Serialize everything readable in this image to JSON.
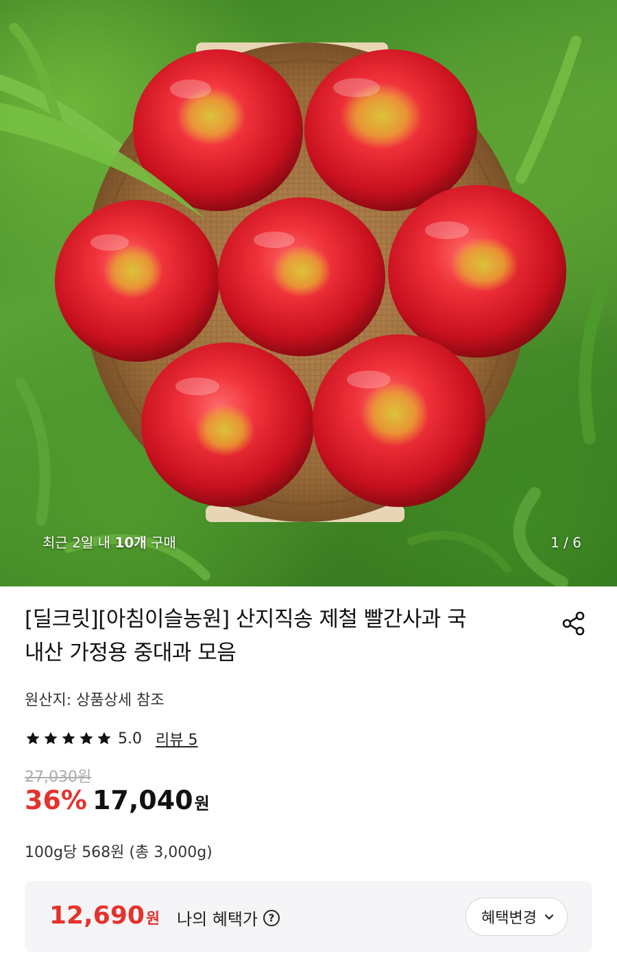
{
  "hero": {
    "image_label": "apples in basket on grass",
    "caption_prefix": "최근 2일 내 ",
    "caption_bold": "10개",
    "caption_suffix": " 구매",
    "page_indicator": "1 / 6"
  },
  "product": {
    "title_line1": "[딜크릿][아침이슬농원] 산지직송 제철 빨간사과 국",
    "title_line2": "내산 가정용 중대과 모음",
    "origin": "원산지: 상품상세 참조",
    "rating": "5.0",
    "star_count": 5,
    "review_link": "리뷰 5",
    "original_price": "27,030원",
    "discount": "36%",
    "price": "17,040",
    "price_unit": "원",
    "unit_price": "100g당 568원 (총 3,000g)"
  },
  "benefit": {
    "amount": "12,690",
    "amount_unit": "원",
    "label": "나의 혜택가",
    "help_icon": "question-circle-icon",
    "button_label": "혜택변경"
  },
  "colors": {
    "accent_red": "#e5322d",
    "muted_gray": "#aaaaaa",
    "benefit_bg": "#f5f5f7"
  }
}
